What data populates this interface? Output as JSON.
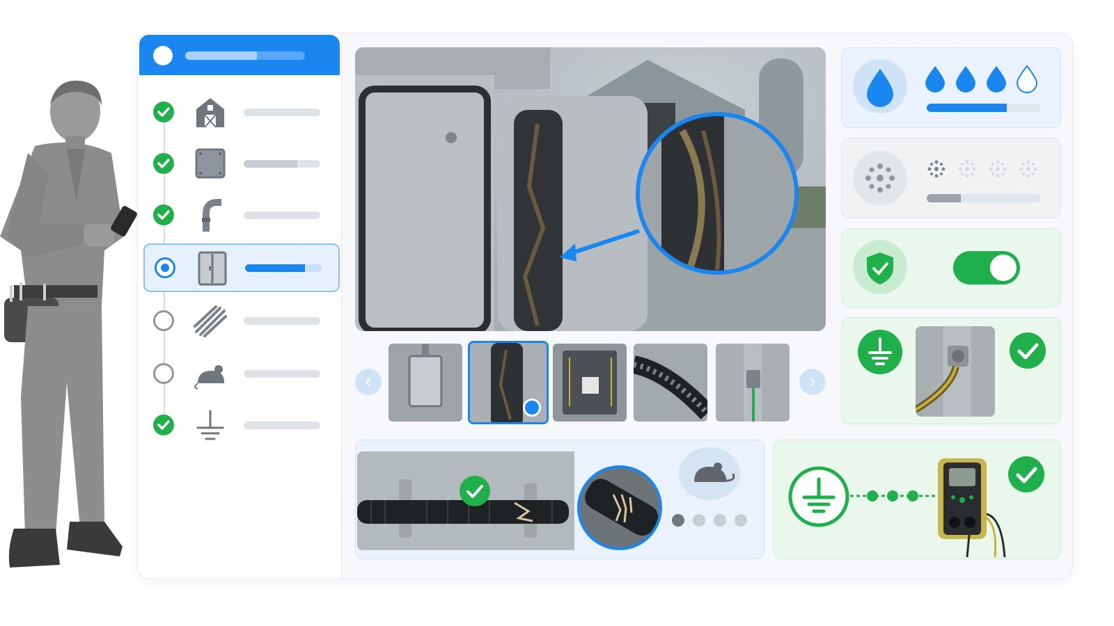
{
  "header": {
    "progress": 0.6
  },
  "checklist": [
    {
      "icon": "barn-icon",
      "status": "done",
      "progress": 0.0
    },
    {
      "icon": "junction-box-icon",
      "status": "done",
      "progress": 0.7
    },
    {
      "icon": "conduit-elbow-icon",
      "status": "done",
      "progress": 0.0
    },
    {
      "icon": "enclosure-door-icon",
      "status": "current",
      "progress": 0.78
    },
    {
      "icon": "cable-bundle-icon",
      "status": "pending",
      "progress": 0.0
    },
    {
      "icon": "rodent-icon",
      "status": "pending",
      "progress": 0.0
    },
    {
      "icon": "ground-symbol-icon",
      "status": "done",
      "progress": 0.0
    }
  ],
  "thumbnails": {
    "count": 5,
    "selected_index": 1
  },
  "moisture": {
    "icon": "water-drop-icon",
    "level": 3,
    "max": 4,
    "progress": 0.7
  },
  "dust": {
    "icon": "dust-icon",
    "level": 1,
    "max": 4,
    "progress": 0.3
  },
  "seal": {
    "icon": "shield-check-icon",
    "toggle_on": true
  },
  "ground_clamp": {
    "icon": "ground-symbol-icon",
    "status": "ok"
  },
  "conduit_damage": {
    "status": "ok",
    "rodent_icon": "rodent-icon",
    "pager_count": 4,
    "pager_active": 0
  },
  "ground_test": {
    "icon": "ground-symbol-icon",
    "meter_icon": "multimeter-icon",
    "status": "ok"
  },
  "colors": {
    "primary": "#1a86f0",
    "success": "#1fb04b",
    "muted": "#8f969f"
  }
}
